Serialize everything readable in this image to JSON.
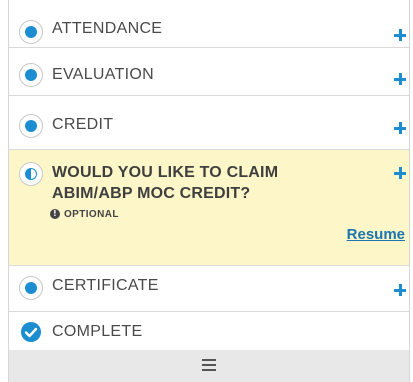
{
  "steps": [
    {
      "label": "ATTENDANCE",
      "state": "incomplete",
      "action_icon": "plus-icon"
    },
    {
      "label": "EVALUATION",
      "state": "incomplete",
      "action_icon": "plus-icon"
    },
    {
      "label": "CREDIT",
      "state": "incomplete",
      "action_icon": "plus-icon"
    },
    {
      "label": "CERTIFICATE",
      "state": "incomplete",
      "action_icon": "plus-icon"
    },
    {
      "label": "COMPLETE",
      "state": "complete",
      "icon": "check-circle-icon"
    }
  ],
  "claim": {
    "title": "WOULD YOU LIKE TO CLAIM ABIM/ABP MOC CREDIT?",
    "state": "in-progress",
    "optional_label": "OPTIONAL",
    "resume_label": "Resume",
    "highlight_color": "#fcf6c8"
  },
  "footer": {
    "icon": "hamburger-menu-icon"
  },
  "colors": {
    "accent": "#1b8dd0",
    "link": "#1c74b0"
  }
}
